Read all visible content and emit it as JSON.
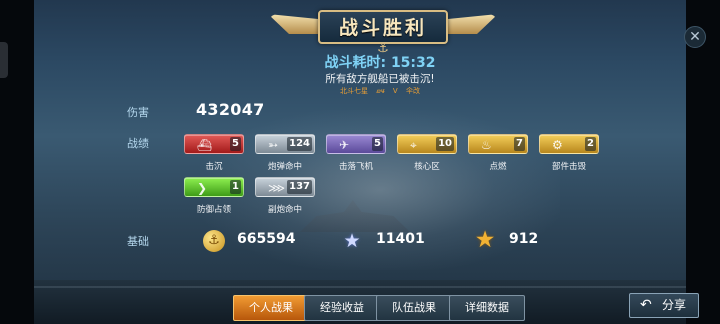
{
  "header": {
    "title": "战斗胜利",
    "battle_time": "战斗耗时: 15:32",
    "message": "所有敌方舰船已被击沉!",
    "players": [
      "北斗七星",
      "ꮺꮰ",
      "V",
      "伞改"
    ]
  },
  "damage": {
    "label": "伤害",
    "value": "432047"
  },
  "records": {
    "label": "战绩",
    "medals": [
      {
        "name": "击沉",
        "count": "5",
        "color": "#c23232",
        "icon": "ship-silhouette-icon"
      },
      {
        "name": "炮弹命中",
        "count": "124",
        "color": "#a6b2bc",
        "icon": "shell-icon"
      },
      {
        "name": "击落飞机",
        "count": "5",
        "color": "#7564b8",
        "icon": "plane-icon"
      },
      {
        "name": "核心区",
        "count": "10",
        "color": "#d9a932",
        "icon": "core-icon"
      },
      {
        "name": "点燃",
        "count": "7",
        "color": "#d9a932",
        "icon": "fire-icon"
      },
      {
        "name": "部件击毁",
        "count": "2",
        "color": "#d9a932",
        "icon": "gear-icon"
      },
      {
        "name": "防御占领",
        "count": "1",
        "color": "#5fce2f",
        "icon": "chevron-icon"
      },
      {
        "name": "副炮命中",
        "count": "137",
        "color": "#a6b2bc",
        "icon": "secondary-gun-icon"
      }
    ]
  },
  "base": {
    "label": "基础",
    "coin": "665594",
    "silver_star": "11401",
    "gold_star": "912"
  },
  "tabs": [
    {
      "label": "个人战果",
      "active": true
    },
    {
      "label": "经验收益",
      "active": false
    },
    {
      "label": "队伍战果",
      "active": false
    },
    {
      "label": "详细数据",
      "active": false
    }
  ],
  "share": {
    "label": "分享"
  },
  "colors": {
    "accent_orange": "#e27a1f",
    "time_blue": "#7fd2f5",
    "player_orange": "#e89e35"
  }
}
